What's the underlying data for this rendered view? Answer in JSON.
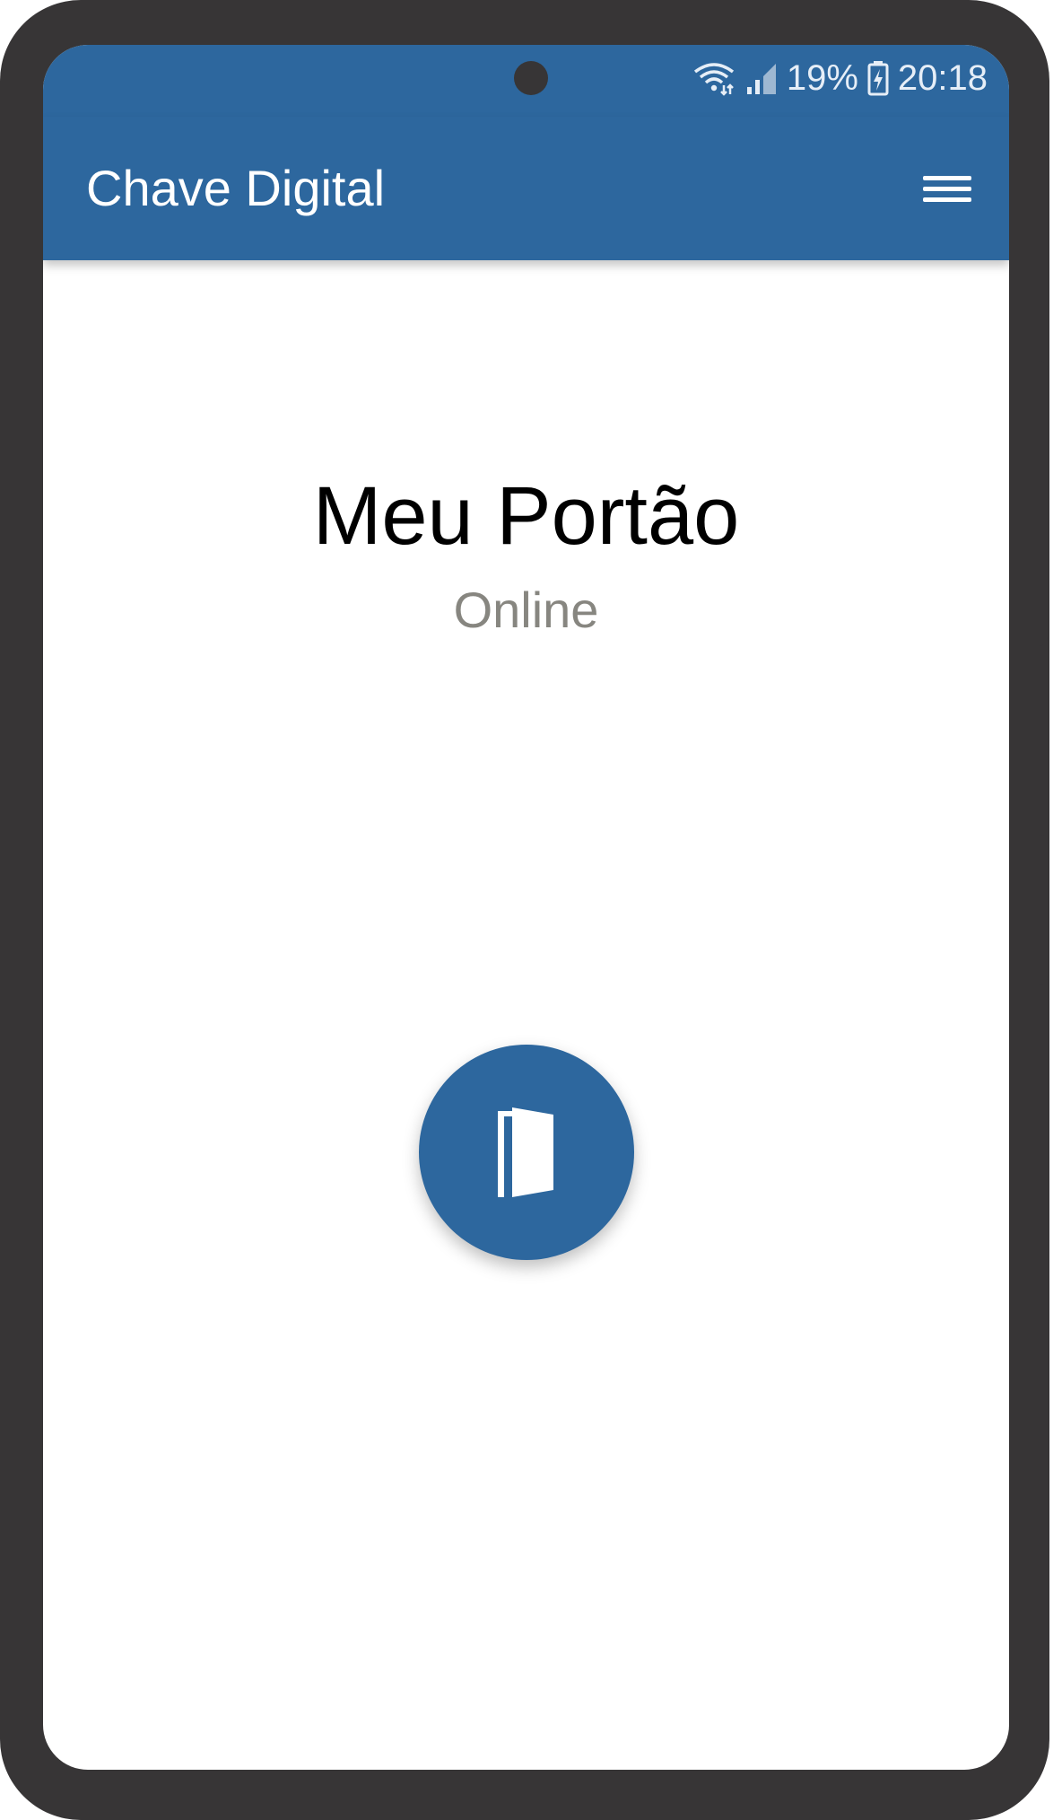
{
  "status_bar": {
    "battery": "19%",
    "time": "20:18"
  },
  "app_bar": {
    "title": "Chave Digital"
  },
  "device": {
    "name": "Meu Portão",
    "status": "Online"
  },
  "icons": {
    "menu": "hamburger-menu-icon",
    "open": "open-door-icon"
  },
  "colors": {
    "primary": "#2d679e",
    "frame": "#373536",
    "status_text": "#878680"
  }
}
